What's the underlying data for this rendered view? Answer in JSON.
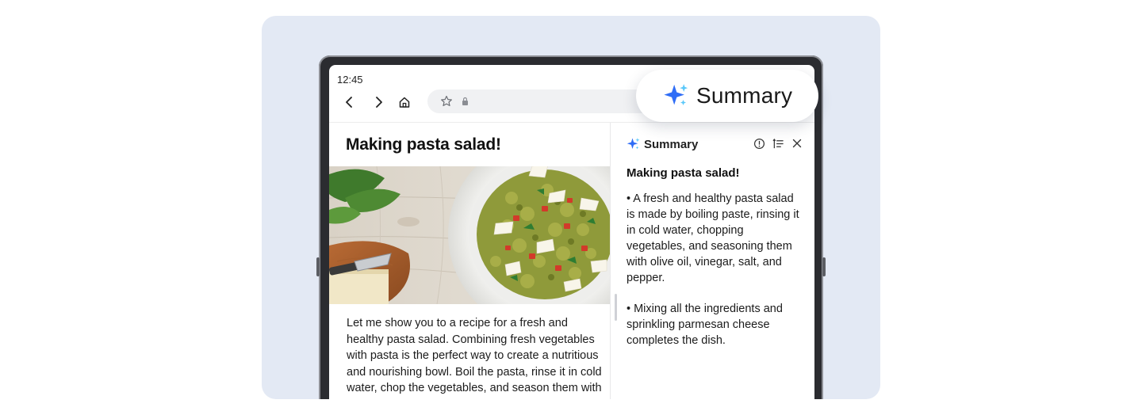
{
  "status": {
    "time": "12:45"
  },
  "toolbar": {
    "back_icon": "chevron-left-icon",
    "forward_icon": "chevron-right-icon",
    "home_icon": "home-icon",
    "bookmark_icon": "star-icon",
    "secure_icon": "lock-icon"
  },
  "article": {
    "title": "Making pasta salad!",
    "body": "Let me show you to a recipe for a fresh and healthy pasta salad. Combining fresh vegetables with pasta is the perfect way to create a nutritious and nourishing bowl. Boil the pasta, rinse it in cold water, chop the vegetables, and season them with olive oil, vinegar, salt, and"
  },
  "summary_panel": {
    "title": "Summary",
    "heading": "Making pasta salad!",
    "bullets": [
      "• A fresh and healthy pasta salad is made by boiling paste, rinsing it in cold water, chopping vegetables, and seasoning them with olive oil, vinegar, salt, and pepper.",
      "• Mixing all the ingredients and sprinkling parmesan cheese completes the dish."
    ],
    "actions": [
      "info-icon",
      "list-format-icon",
      "close-icon"
    ]
  },
  "summary_pill": {
    "label": "Summary"
  },
  "colors": {
    "stage_bg": "#e3e9f4",
    "sparkle_blue": "#2f6df6",
    "sparkle_light": "#5ac8fa"
  }
}
